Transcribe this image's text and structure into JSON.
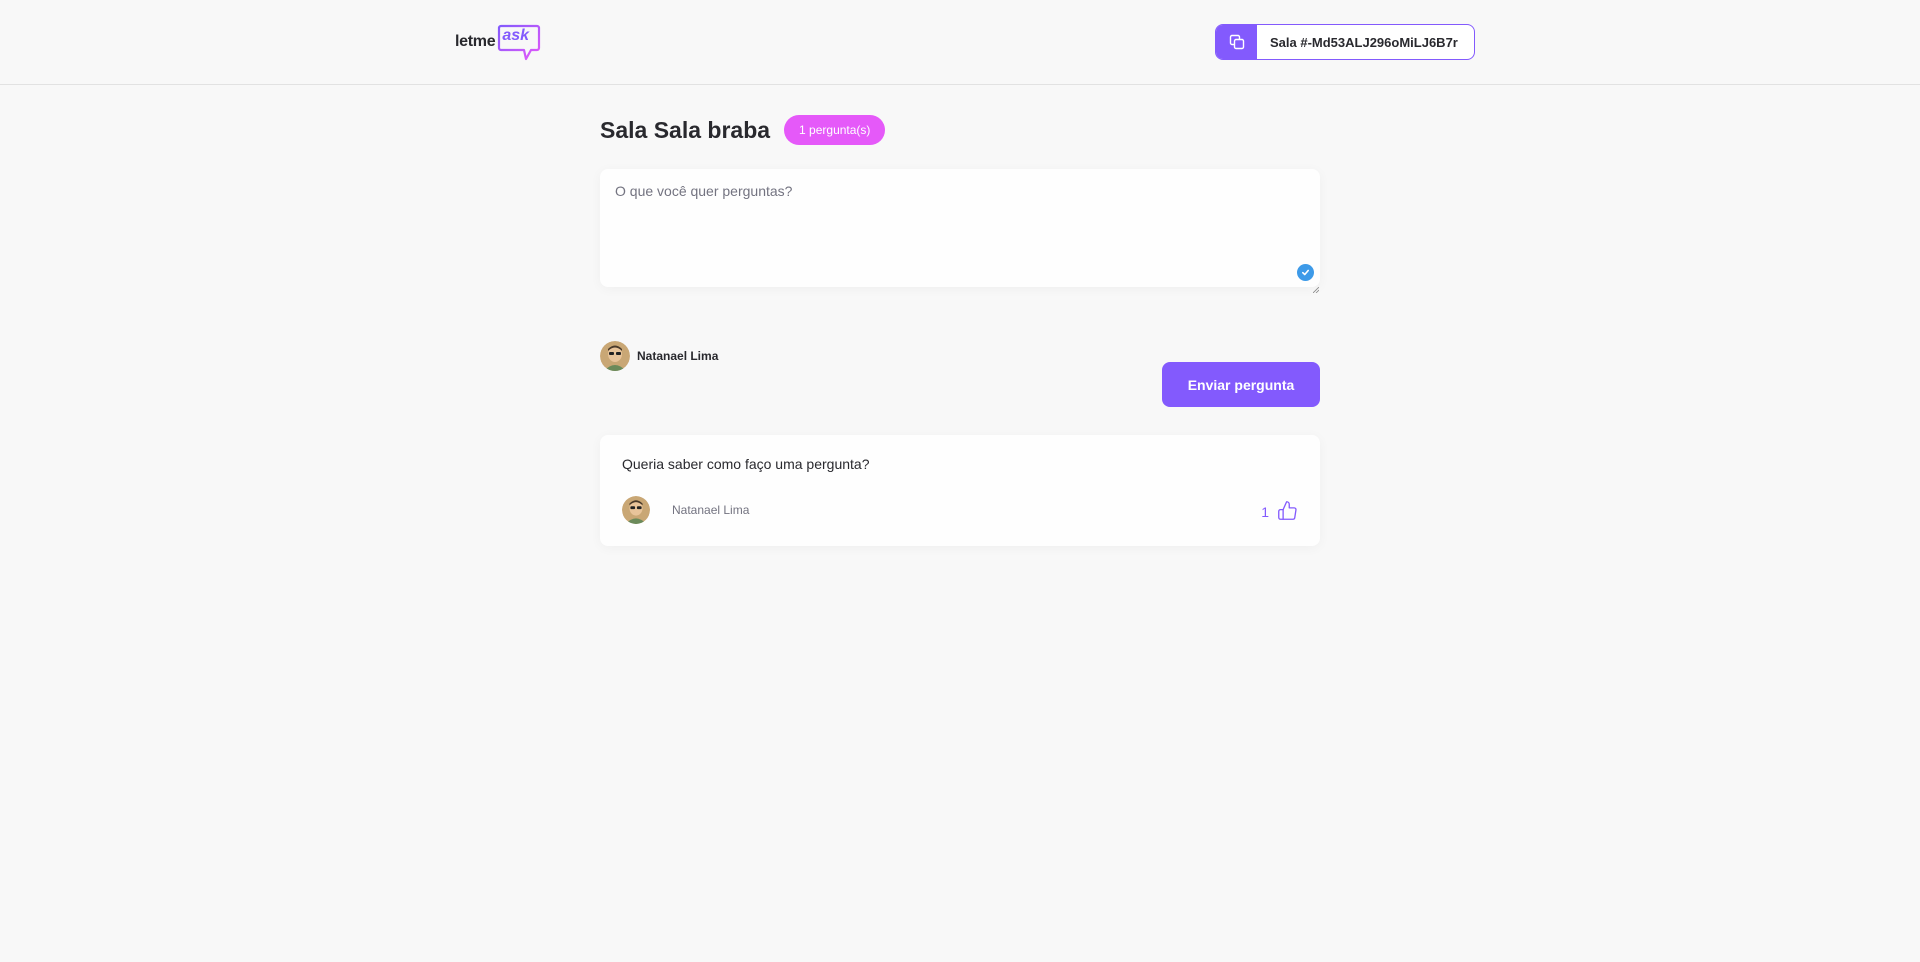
{
  "header": {
    "logo_text": "letme",
    "logo_bubble_text": "ask",
    "room_code_label": "Sala #-Md53ALJ296oMiLJ6B7r"
  },
  "room": {
    "title": "Sala Sala braba",
    "question_count_badge": "1 pergunta(s)"
  },
  "form": {
    "placeholder": "O que você quer perguntas?",
    "value": "",
    "user_name": "Natanael Lima",
    "submit_label": "Enviar pergunta"
  },
  "questions": [
    {
      "content": "Queria saber como faço uma pergunta?",
      "author": "Natanael Lima",
      "like_count": "1"
    }
  ],
  "colors": {
    "primary": "#835afd",
    "badge": "#e559f9",
    "background": "#f8f8f8",
    "text": "#29292e",
    "muted": "#737380",
    "grammar_check": "#3d9ae8"
  },
  "icons": {
    "copy": "copy-icon",
    "like": "thumbs-up-icon",
    "grammar": "check-circle-icon"
  }
}
